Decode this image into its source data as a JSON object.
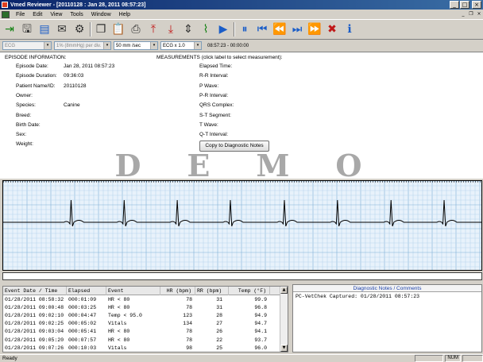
{
  "window": {
    "title": "Vmed Reviewer - [20110128 : Jan 28, 2011  08:57:23]",
    "minimize": "_",
    "maximize": "□",
    "close": "×"
  },
  "menu": {
    "items": [
      "File",
      "Edit",
      "View",
      "Tools",
      "Window",
      "Help"
    ],
    "mdi_minimize": "_",
    "mdi_restore": "❐",
    "mdi_close": "×"
  },
  "toolbar": {
    "buttons": [
      {
        "icon": "open-icon",
        "glyph": "⇥"
      },
      {
        "icon": "save-icon",
        "glyph": "🖫"
      },
      {
        "icon": "save-all-icon",
        "glyph": "▤"
      },
      {
        "icon": "folder-icon",
        "glyph": "✉"
      },
      {
        "icon": "settings-icon",
        "glyph": "⚙"
      },
      {
        "icon": "copy-icon",
        "glyph": "❐"
      },
      {
        "icon": "paste-icon",
        "glyph": "📋"
      },
      {
        "icon": "print-icon",
        "glyph": "⎙"
      },
      {
        "icon": "upload-red-icon",
        "glyph": "⤒"
      },
      {
        "icon": "download-red-icon",
        "glyph": "⤓"
      },
      {
        "icon": "compress-icon",
        "glyph": "⇕"
      },
      {
        "icon": "measure-icon",
        "glyph": "⌇"
      },
      {
        "icon": "play-icon",
        "glyph": "▶"
      },
      {
        "icon": "pause-icon",
        "glyph": "⏸"
      },
      {
        "icon": "first-icon",
        "glyph": "⏮"
      },
      {
        "icon": "rewind-icon",
        "glyph": "⏪"
      },
      {
        "icon": "next-event-icon",
        "glyph": "⏭"
      },
      {
        "icon": "fast-forward-icon",
        "glyph": "⏩"
      },
      {
        "icon": "delete-event-icon",
        "glyph": "✖"
      },
      {
        "icon": "help-icon",
        "glyph": "ℹ"
      }
    ]
  },
  "params": {
    "lead": "ECG",
    "scale": "1% (8mmHg) per div.",
    "speed": "50 mm /sec",
    "gain": "ECG x 1.0",
    "time": "08:57:23 - 00:00:00",
    "arrow": "▾"
  },
  "episode": {
    "heading": "EPISODE INFORMATION:",
    "fields": [
      {
        "label": "Episode Date:",
        "value": "Jan 28, 2011   08:57:23"
      },
      {
        "label": "Episode Duration:",
        "value": "09:36:03"
      },
      {
        "label": "Patient Name/ID:",
        "value": "20110128"
      },
      {
        "label": "Owner:",
        "value": ""
      },
      {
        "label": "Species:",
        "value": "Canine"
      },
      {
        "label": "Breed:",
        "value": ""
      },
      {
        "label": "Birth Date:",
        "value": ""
      },
      {
        "label": "Sex:",
        "value": ""
      },
      {
        "label": "Weight:",
        "value": ""
      }
    ]
  },
  "measurements": {
    "heading": "MEASUREMENTS (click label to select measurement):",
    "items": [
      "Elapsed Time:",
      "R-R Interval:",
      "P Wave:",
      "P-R Interval:",
      "QRS Complex:",
      "S-T Segment:",
      "T Wave:",
      "Q-T Interval:"
    ],
    "copy_button": "Copy to Diagnostic Notes"
  },
  "watermark": "DEMO",
  "events": {
    "headers": [
      "Event Date / Time",
      "Elapsed",
      "Event",
      "HR (bpm)",
      "RR (bpm)",
      "Temp (°F)"
    ],
    "rows": [
      [
        "01/28/2011 08:58:32",
        "000:01:09",
        "HR < 80",
        "78",
        "31",
        "99.9"
      ],
      [
        "01/28/2011 09:00:48",
        "000:03:25",
        "HR < 80",
        "78",
        "31",
        "96.8"
      ],
      [
        "01/28/2011 09:02:10",
        "000:04:47",
        "Temp <  95.0",
        "123",
        "28",
        "94.9"
      ],
      [
        "01/28/2011 09:02:25",
        "000:05:02",
        "Vitals",
        "134",
        "27",
        "94.7"
      ],
      [
        "01/28/2011 09:03:04",
        "000:05:41",
        "HR < 80",
        "78",
        "26",
        "94.1"
      ],
      [
        "01/28/2011 09:05:20",
        "000:07:57",
        "HR < 80",
        "78",
        "22",
        "93.7"
      ],
      [
        "01/28/2011 09:07:26",
        "000:10:03",
        "Vitals",
        "98",
        "25",
        "96.0"
      ]
    ],
    "scroll_up": "▲",
    "scroll_down": "▼"
  },
  "notes": {
    "heading": "Diagnostic Notes / Comments",
    "text": "PC-VetChek Captured: 01/28/2011 08:57:23"
  },
  "ecg": {
    "beat_times_fraction": [
      0.142,
      0.253,
      0.364,
      0.475,
      0.588,
      0.699,
      0.811,
      0.922
    ]
  },
  "status": {
    "text": "Ready",
    "num": "NUM"
  }
}
